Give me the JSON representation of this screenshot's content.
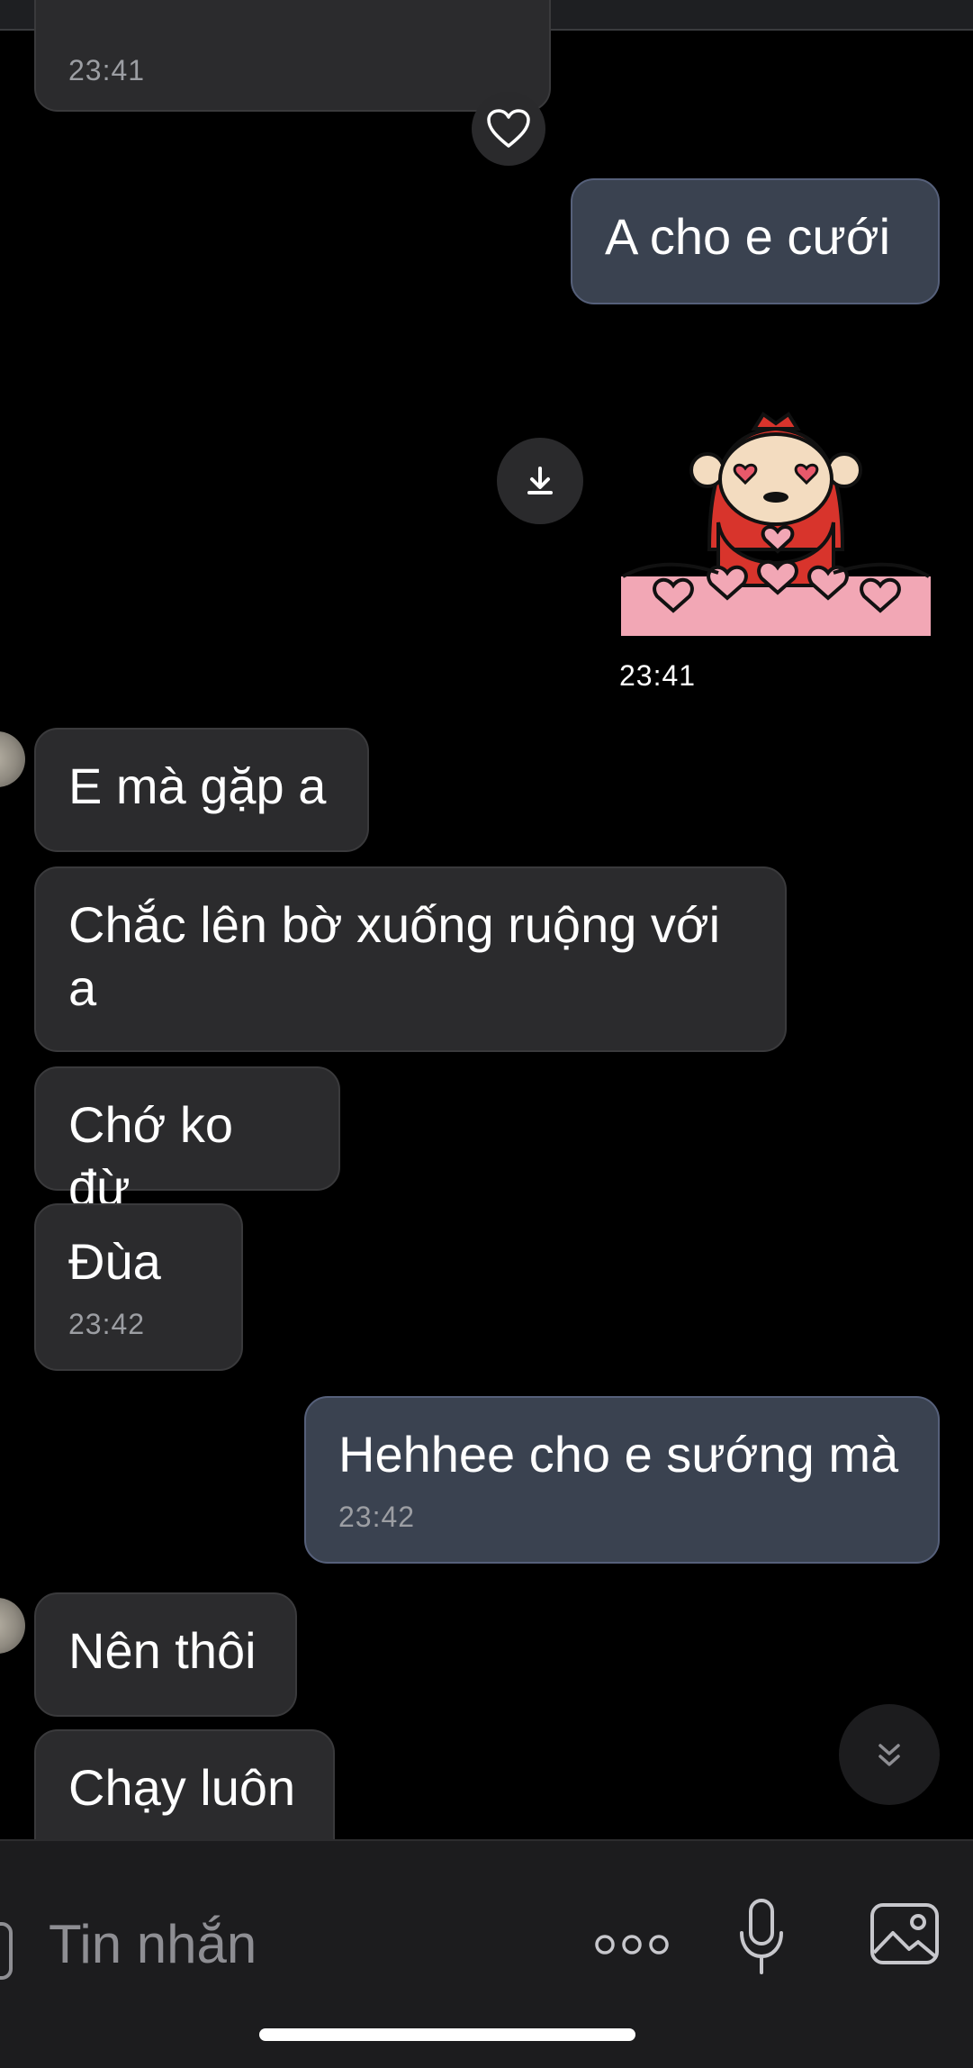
{
  "conversation": {
    "messages": [
      {
        "direction": "in",
        "text": "",
        "time": "23:41",
        "reaction": "heart-icon"
      },
      {
        "direction": "out",
        "text": "A cho e cưới"
      },
      {
        "direction": "out",
        "type": "sticker",
        "sticker": "monkey-in-hearts-sticker",
        "time": "23:41"
      },
      {
        "direction": "in",
        "text": "E mà gặp a"
      },
      {
        "direction": "in",
        "text": "Chắc lên bờ xuống ruộng với a"
      },
      {
        "direction": "in",
        "text": "Chớ ko đừ"
      },
      {
        "direction": "in",
        "text": "Đùa",
        "time": "23:42"
      },
      {
        "direction": "out",
        "text": "Hehhee cho e sướng mà",
        "time": "23:42"
      },
      {
        "direction": "in",
        "text": "Nên thôi"
      },
      {
        "direction": "in",
        "text": "Chạy luôn"
      }
    ]
  },
  "composer": {
    "placeholder": "Tin nhắn",
    "icons": [
      "more-icon",
      "microphone-icon",
      "image-icon"
    ]
  },
  "colors": {
    "background": "#000000",
    "incoming_bubble": "#2b2b2d",
    "outgoing_bubble": "#3a4250",
    "timestamp": "#9c9ea3"
  }
}
